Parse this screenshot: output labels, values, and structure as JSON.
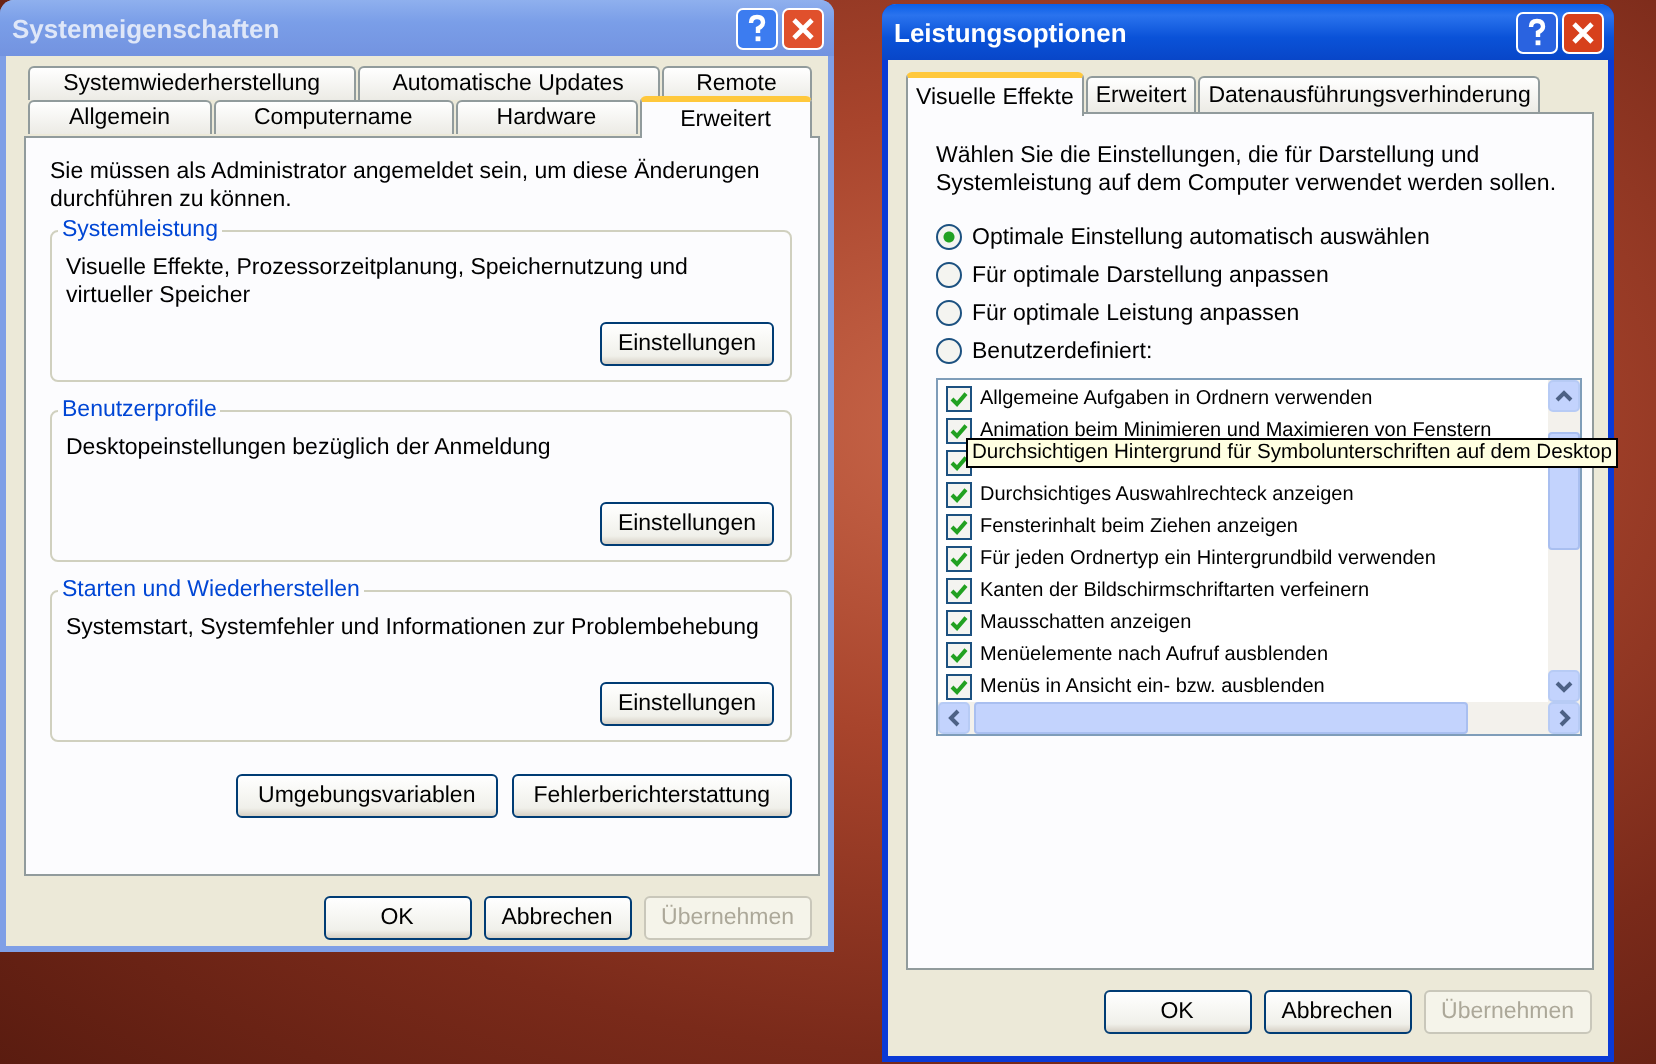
{
  "system_properties": {
    "title": "Systemeigenschaften",
    "tab_rows": [
      [
        {
          "label": "Systemwiederherstellung",
          "selected": false
        },
        {
          "label": "Automatische Updates",
          "selected": false
        },
        {
          "label": "Remote",
          "selected": false
        }
      ],
      [
        {
          "label": "Allgemein",
          "selected": false
        },
        {
          "label": "Computername",
          "selected": false
        },
        {
          "label": "Hardware",
          "selected": false
        },
        {
          "label": "Erweitert",
          "selected": true
        }
      ]
    ],
    "intro": "Sie müssen als Administrator angemeldet sein, um diese Änderungen durchführen zu können.",
    "groups": [
      {
        "title": "Systemleistung",
        "text": "Visuelle Effekte, Prozessorzeitplanung, Speichernutzung und virtueller Speicher",
        "button": "Einstellungen"
      },
      {
        "title": "Benutzerprofile",
        "text": "Desktopeinstellungen bezüglich der Anmeldung",
        "button": "Einstellungen"
      },
      {
        "title": "Starten und Wiederherstellen",
        "text": "Systemstart, Systemfehler und Informationen zur Problembehebung",
        "button": "Einstellungen"
      }
    ],
    "extra_buttons": [
      "Umgebungsvariablen",
      "Fehlerberichterstattung"
    ],
    "buttons": [
      {
        "label": "OK",
        "disabled": false
      },
      {
        "label": "Abbrechen",
        "disabled": false
      },
      {
        "label": "Übernehmen",
        "disabled": true
      }
    ]
  },
  "performance_options": {
    "title": "Leistungsoptionen",
    "tabs": [
      {
        "label": "Visuelle Effekte",
        "selected": true
      },
      {
        "label": "Erweitert",
        "selected": false
      },
      {
        "label": "Datenausführungsverhinderung",
        "selected": false
      }
    ],
    "intro": "Wählen Sie die Einstellungen, die für Darstellung und Systemleistung auf dem Computer verwendet werden sollen.",
    "options": [
      {
        "label": "Optimale Einstellung automatisch auswählen",
        "selected": true
      },
      {
        "label": "Für optimale Darstellung anpassen",
        "selected": false
      },
      {
        "label": "Für optimale Leistung anpassen",
        "selected": false
      },
      {
        "label": "Benutzerdefiniert:",
        "selected": false
      }
    ],
    "effects": [
      {
        "label": "Allgemeine Aufgaben in Ordnern verwenden",
        "checked": true
      },
      {
        "label": "Animation beim Minimieren und Maximieren von Fenstern",
        "checked": true
      },
      {
        "checked": true
      },
      {
        "label": "Durchsichtiges Auswahlrechteck anzeigen",
        "checked": true
      },
      {
        "label": "Fensterinhalt beim Ziehen anzeigen",
        "checked": true
      },
      {
        "label": "Für jeden Ordnertyp ein Hintergrundbild verwenden",
        "checked": true
      },
      {
        "label": "Kanten der Bildschirmschriftarten verfeinern",
        "checked": true
      },
      {
        "label": "Mausschatten anzeigen",
        "checked": true
      },
      {
        "label": "Menüelemente nach Aufruf ausblenden",
        "checked": true
      },
      {
        "label": "Menüs in Ansicht ein- bzw. ausblenden",
        "checked": true
      }
    ],
    "buttons": [
      {
        "label": "OK",
        "disabled": false
      },
      {
        "label": "Abbrechen",
        "disabled": false
      },
      {
        "label": "Übernehmen",
        "disabled": true
      }
    ]
  },
  "tooltip": "Durchsichtigen Hintergrund für Symbolunterschriften auf dem Desktop"
}
